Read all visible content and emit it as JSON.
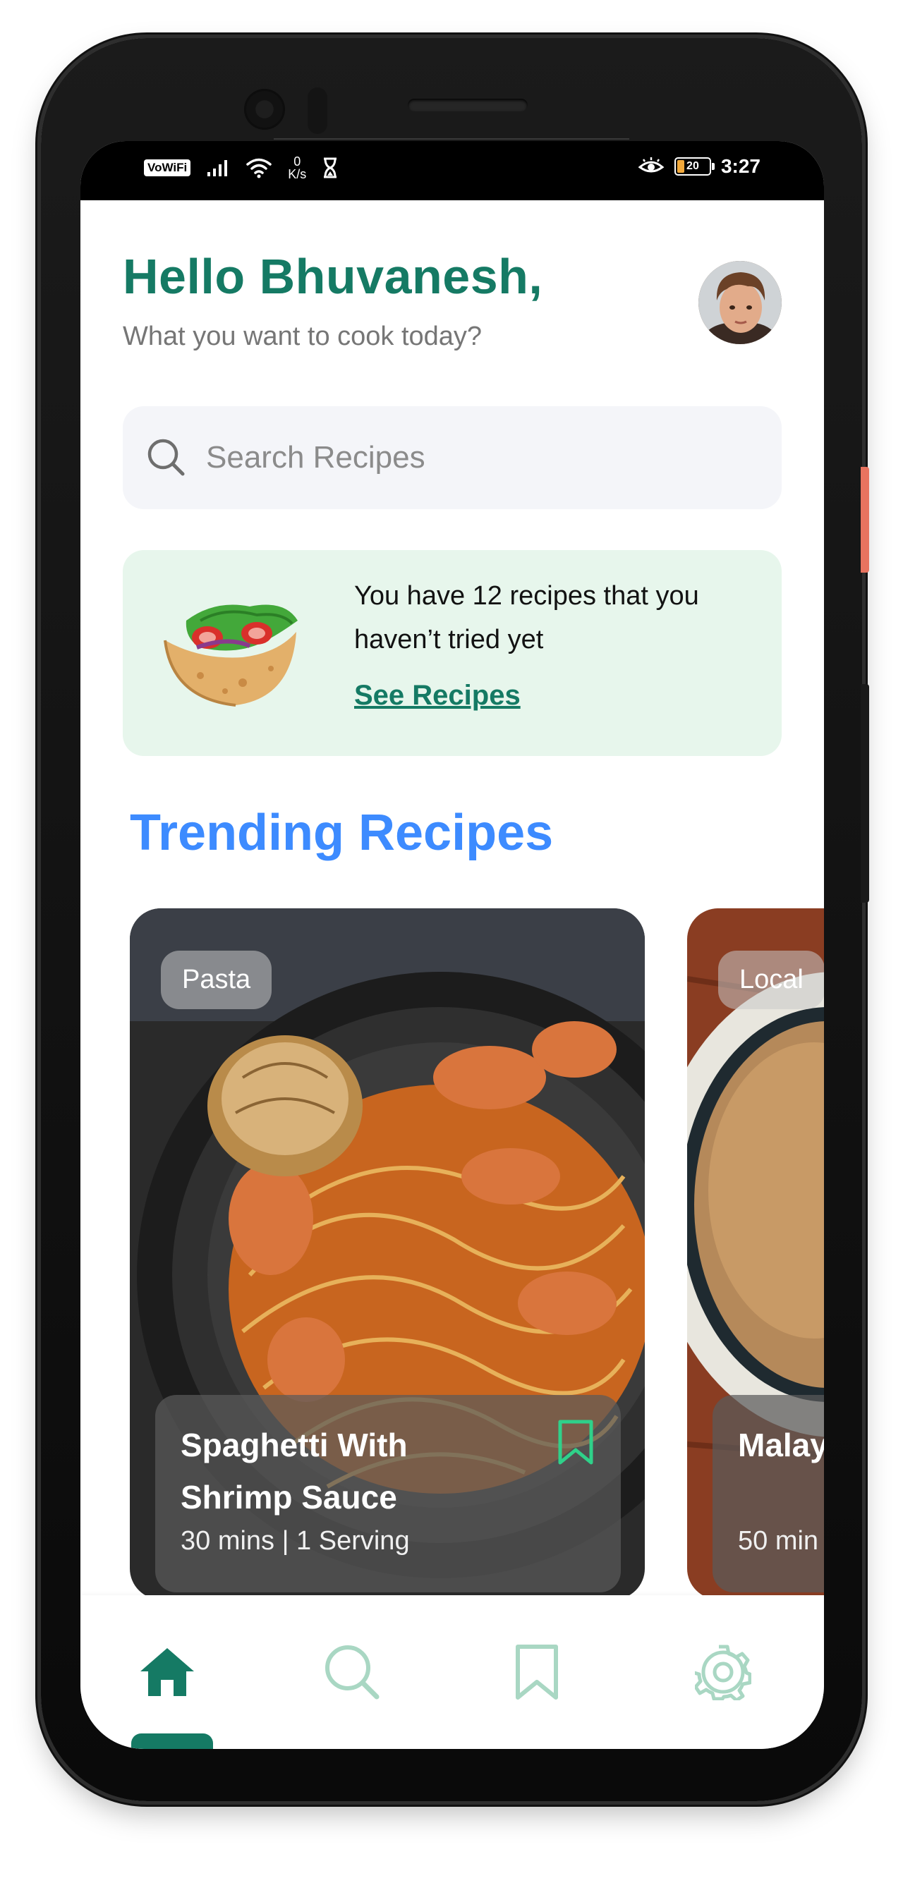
{
  "status_bar": {
    "vowifi": "VoWiFi",
    "speed_value": "0",
    "speed_unit": "K/s",
    "battery": "20",
    "time": "3:27"
  },
  "header": {
    "greeting": "Hello Bhuvanesh,",
    "subtitle": "What you want to cook today?",
    "avatar_icon": "user-avatar"
  },
  "search": {
    "placeholder": "Search Recipes",
    "icon": "search-icon"
  },
  "promo": {
    "message": "You have 12 recipes that you haven’t tried yet",
    "link_label": "See Recipes",
    "icon": "taco-icon"
  },
  "trending": {
    "title": "Trending Recipes",
    "cards": [
      {
        "category": "Pasta",
        "name": "Spaghetti With Shrimp Sauce",
        "meta": "30 mins | 1 Serving"
      },
      {
        "category": "Local",
        "name": "Malay Satay",
        "meta": "50 min"
      }
    ]
  },
  "bottom_nav": {
    "items": [
      {
        "icon": "home-icon",
        "active": true
      },
      {
        "icon": "search-icon",
        "active": false
      },
      {
        "icon": "bookmark-icon",
        "active": false
      },
      {
        "icon": "settings-icon",
        "active": false
      }
    ]
  },
  "colors": {
    "primary": "#157a64",
    "accent_blue": "#3d8bff",
    "promo_bg": "#e7f6ec",
    "search_bg": "#f4f5f9",
    "bookmark_green": "#2fd18a"
  }
}
